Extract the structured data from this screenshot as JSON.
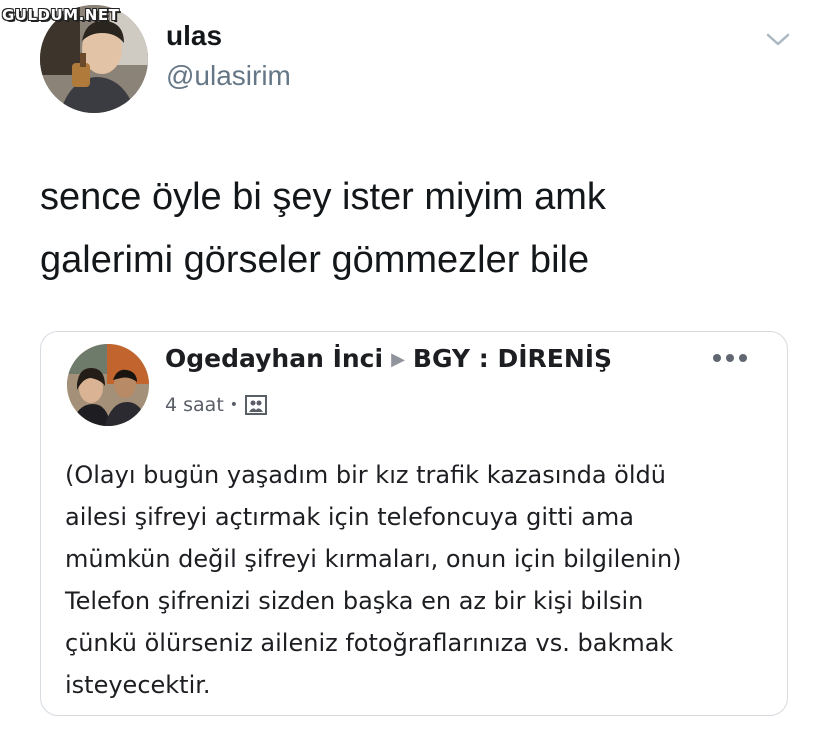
{
  "watermark": "GULDUM.NET",
  "tweet": {
    "user_name": "ulas",
    "user_handle": "@ulasirim",
    "text_lines": [
      "sence öyle bi şey ister miyim amk",
      "galerimi görseler gömmezler bile"
    ]
  },
  "facebook_post": {
    "author": "Ogedayhan İnci",
    "group": "BGY : DİRENİŞ",
    "time": "4 saat",
    "body_lines": [
      "(Olayı bugün yaşadım bir kız trafik kazasında öldü",
      "ailesi şifreyi açtırmak için telefoncuya gitti ama",
      "mümkün değil şifreyi kırmaları, onun için bilgilenin)",
      "Telefon şifrenizi sizden başka en az bir kişi bilsin",
      "çünkü ölürseniz aileniz fotoğraflarınıza vs. bakmak",
      "isteyecektir."
    ]
  },
  "icons": {
    "more": "chevron-down-icon",
    "audience": "photo-icon",
    "options": "more-horizontal-icon"
  }
}
